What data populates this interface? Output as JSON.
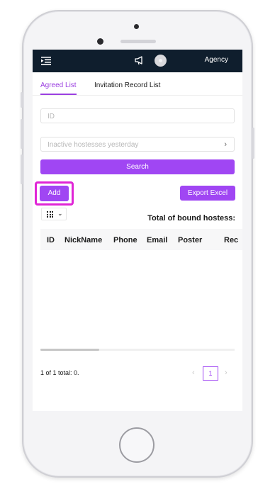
{
  "header": {
    "menu_icon": "menu-indent-icon",
    "notice_icon": "megaphone-icon",
    "avatar_icon": "avatar-icon",
    "right_label": "Agency",
    "bg_color": "#0f1e2d"
  },
  "tabs": [
    {
      "label": "Agreed List",
      "active": true
    },
    {
      "label": "Invitation Record List",
      "active": false
    }
  ],
  "filters": {
    "id_placeholder": "ID",
    "status_placeholder": "Inactive hostesses yesterday",
    "search_label": "Search"
  },
  "actions": {
    "add_label": "Add",
    "export_label": "Export Excel"
  },
  "summary": {
    "total_label": "Total of bound hostess:"
  },
  "table": {
    "columns": [
      "ID",
      "NickName",
      "Phone",
      "Email",
      "Poster",
      "Rec"
    ],
    "rows": []
  },
  "pagination": {
    "info": "1 of 1 total: 0.",
    "current_page": "1",
    "prev_icon": "chevron-left-icon",
    "next_icon": "chevron-right-icon"
  },
  "colors": {
    "accent": "#a046f3",
    "highlight": "#e024d6"
  }
}
